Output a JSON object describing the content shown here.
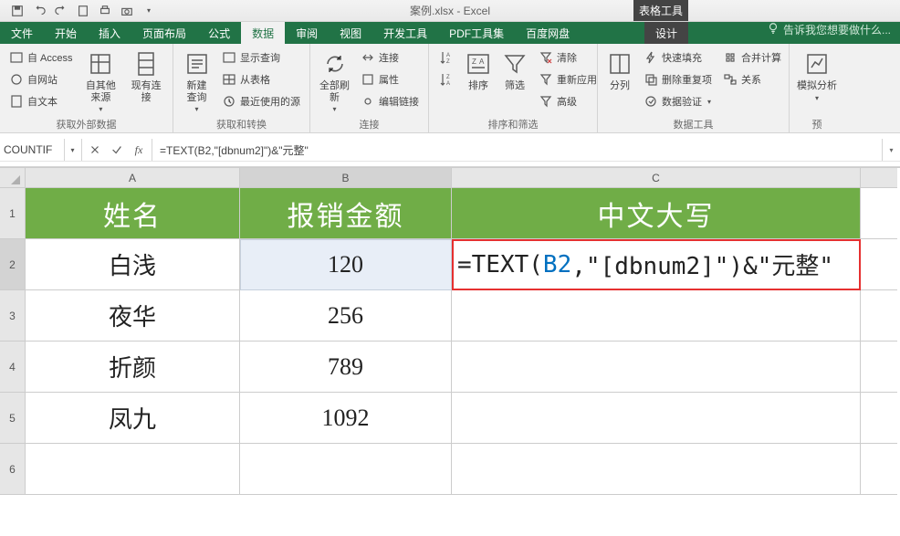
{
  "app": {
    "title": "案例.xlsx - Excel",
    "context_tab_group": "表格工具"
  },
  "qat": {
    "save": "保存",
    "undo": "撤销",
    "redo": "重做",
    "new": "新建",
    "print_preview": "打印预览",
    "touch_mode": "触摸模式"
  },
  "tabs": {
    "file": "文件",
    "home": "开始",
    "insert": "插入",
    "page_layout": "页面布局",
    "formulas": "公式",
    "data": "数据",
    "review": "审阅",
    "view": "视图",
    "developer": "开发工具",
    "pdf": "PDF工具集",
    "baidu": "百度网盘",
    "design": "设计",
    "tell_me": "告诉我您想要做什么..."
  },
  "ribbon": {
    "group1": {
      "title": "获取外部数据",
      "from_access": "自 Access",
      "from_web": "自网站",
      "from_text": "自文本",
      "from_other": "自其他来源",
      "existing": "现有连接"
    },
    "group2": {
      "title": "获取和转换",
      "new_query": "新建\n查询",
      "show_queries": "显示查询",
      "from_table": "从表格",
      "recent_sources": "最近使用的源"
    },
    "group3": {
      "title": "连接",
      "refresh_all": "全部刷新",
      "connections": "连接",
      "properties": "属性",
      "edit_links": "编辑链接"
    },
    "group4": {
      "title": "排序和筛选",
      "sort_az": "升序",
      "sort_za": "降序",
      "sort": "排序",
      "filter": "筛选",
      "clear": "清除",
      "reapply": "重新应用",
      "advanced": "高级"
    },
    "group5": {
      "title": "数据工具",
      "text_to_columns": "分列",
      "flash_fill": "快速填充",
      "remove_duplicates": "删除重复项",
      "data_validation": "数据验证",
      "consolidate": "合并计算",
      "relationships": "关系"
    },
    "group6": {
      "title": "预",
      "what_if": "模拟分析"
    }
  },
  "formula_bar": {
    "name_box": "COUNTIF",
    "fx_label": "fx",
    "formula": "=TEXT(B2,\"[dbnum2]\")&\"元整\""
  },
  "sheet": {
    "col_A": "A",
    "col_B": "B",
    "col_C": "C",
    "rows": [
      "1",
      "2",
      "3",
      "4",
      "5",
      "6"
    ],
    "h_name": "姓名",
    "h_amount": "报销金额",
    "h_chinese": "中文大写",
    "data": [
      {
        "name": "白浅",
        "amount": "120"
      },
      {
        "name": "夜华",
        "amount": "256"
      },
      {
        "name": "折颜",
        "amount": "789"
      },
      {
        "name": "凤九",
        "amount": "1092"
      }
    ],
    "editing": {
      "pre": "=TEXT(",
      "ref": "B2",
      "post": ",\"[dbnum2]\")&\"元整\""
    }
  }
}
